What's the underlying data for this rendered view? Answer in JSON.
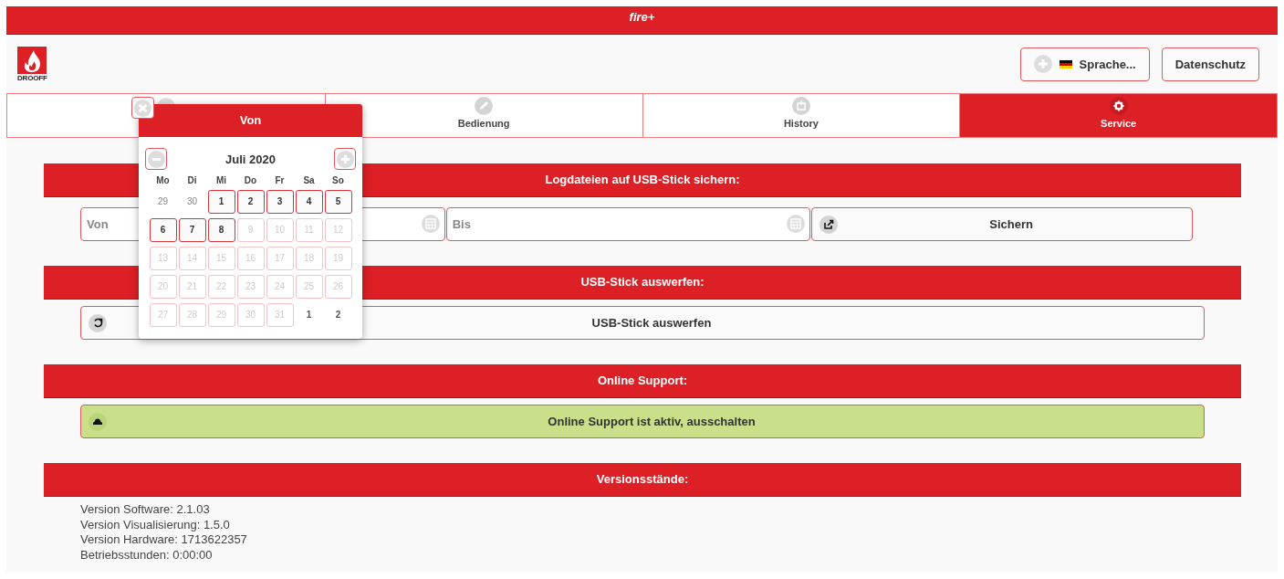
{
  "app_title": "fire+",
  "logo": {
    "text": "DROOFF"
  },
  "header_buttons": [
    {
      "kind": "language",
      "label": "Sprache..."
    },
    {
      "kind": "plain",
      "label": "Datenschutz"
    }
  ],
  "tabs": [
    {
      "selected": false
    },
    {
      "label": "Bedienung",
      "selected": false
    },
    {
      "label": "History",
      "selected": false
    },
    {
      "label": "Service",
      "selected": true
    }
  ],
  "sections": [
    {
      "title": "Logdateien auf USB-Stick sichern:",
      "kind": "fields",
      "fields": [
        {
          "placeholder": "Von"
        },
        {
          "placeholder": "Bis"
        }
      ],
      "button": {
        "label": "Sichern",
        "active": false
      }
    },
    {
      "title": "USB-Stick auswerfen:",
      "kind": "button",
      "button": {
        "label": "USB-Stick auswerfen",
        "active": false
      }
    },
    {
      "title": "Online Support:",
      "kind": "button",
      "button": {
        "label": "Online Support ist aktiv, ausschalten",
        "active": true
      }
    },
    {
      "title": "Versionsstände:",
      "kind": "text",
      "lines": [
        "Version Software: 2.1.03",
        "Version Visualisierung: 1.5.0",
        "Version Hardware: 1713622357",
        "Betriebsstunden: 0:00:00"
      ]
    }
  ],
  "date_picker": {
    "title": "Von",
    "month": "Juli 2020",
    "weekdays": [
      "Mo",
      "Di",
      "Mi",
      "Do",
      "Fr",
      "Sa",
      "So"
    ],
    "days": [
      {
        "label": "29",
        "kind": "other"
      },
      {
        "label": "30",
        "kind": "other"
      },
      {
        "label": "1",
        "kind": "enabled"
      },
      {
        "label": "2",
        "kind": "enabled"
      },
      {
        "label": "3",
        "kind": "enabled"
      },
      {
        "label": "4",
        "kind": "enabled"
      },
      {
        "label": "5",
        "kind": "enabled"
      },
      {
        "label": "6",
        "kind": "enabled"
      },
      {
        "label": "7",
        "kind": "enabled"
      },
      {
        "label": "8",
        "kind": "enabled"
      },
      {
        "label": "9",
        "kind": "disabled"
      },
      {
        "label": "10",
        "kind": "disabled"
      },
      {
        "label": "11",
        "kind": "disabled"
      },
      {
        "label": "12",
        "kind": "disabled"
      },
      {
        "label": "13",
        "kind": "disabled"
      },
      {
        "label": "14",
        "kind": "disabled"
      },
      {
        "label": "15",
        "kind": "disabled"
      },
      {
        "label": "16",
        "kind": "disabled"
      },
      {
        "label": "17",
        "kind": "disabled"
      },
      {
        "label": "18",
        "kind": "disabled"
      },
      {
        "label": "19",
        "kind": "disabled"
      },
      {
        "label": "20",
        "kind": "disabled"
      },
      {
        "label": "21",
        "kind": "disabled"
      },
      {
        "label": "22",
        "kind": "disabled"
      },
      {
        "label": "23",
        "kind": "disabled"
      },
      {
        "label": "24",
        "kind": "disabled"
      },
      {
        "label": "25",
        "kind": "disabled"
      },
      {
        "label": "26",
        "kind": "disabled"
      },
      {
        "label": "27",
        "kind": "disabled"
      },
      {
        "label": "28",
        "kind": "disabled"
      },
      {
        "label": "29",
        "kind": "disabled"
      },
      {
        "label": "30",
        "kind": "disabled"
      },
      {
        "label": "31",
        "kind": "disabled"
      },
      {
        "label": "1",
        "kind": "next"
      },
      {
        "label": "2",
        "kind": "next"
      }
    ]
  }
}
